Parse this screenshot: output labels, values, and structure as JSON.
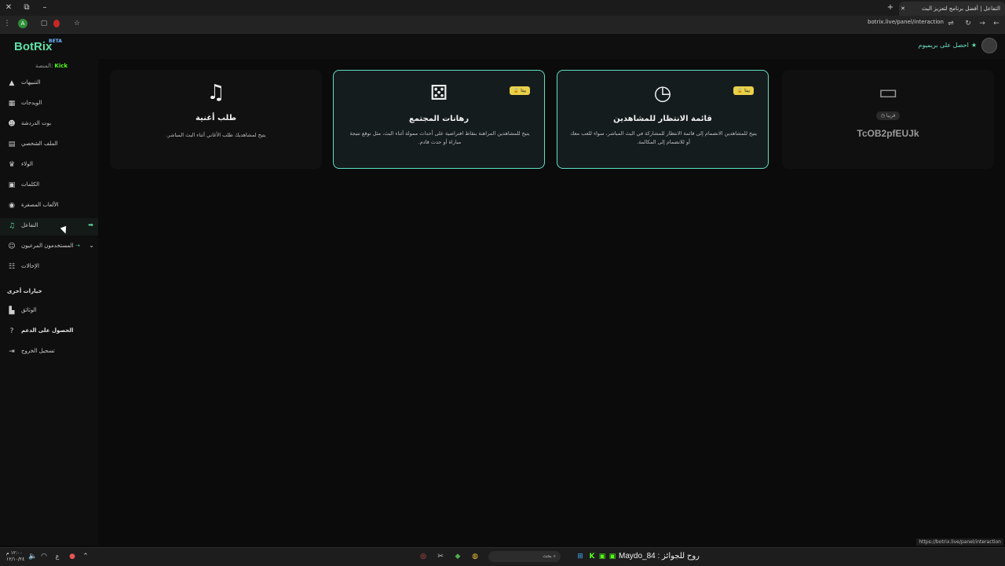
{
  "browser": {
    "tab_title": "التفاعل | أفضل برنامج لتعزيز البث",
    "url": "botrix.live/panel/interaction",
    "status_url": "https://botrix.live/panel/interaction"
  },
  "header": {
    "logo": "BotRix",
    "beta": "BETA",
    "premium_label": "احصل على بريميوم"
  },
  "sidebar": {
    "platform_label": "المنصة:",
    "platform_name": "Kick",
    "items": [
      {
        "label": "التنبيهات",
        "icon": "alert-icon"
      },
      {
        "label": "الويدجات",
        "icon": "grid-icon"
      },
      {
        "label": "بوت الدردشة",
        "icon": "robot-icon"
      },
      {
        "label": "الملف الشخصي",
        "icon": "id-card-icon"
      },
      {
        "label": "الولاء",
        "icon": "trophy-icon"
      },
      {
        "label": "الكلمات",
        "icon": "square-icon"
      },
      {
        "label": "الألعاب المصغرة",
        "icon": "gamepad-icon"
      },
      {
        "label": "التفاعل",
        "icon": "music-icon"
      },
      {
        "label": "المستخدمون المرعيون",
        "icon": "users-icon"
      },
      {
        "label": "الإحالات",
        "icon": "referral-icon"
      }
    ],
    "section_other": "خيارات أخرى",
    "other_items": [
      {
        "label": "الوثائق",
        "icon": "book-icon"
      },
      {
        "label": "الحصول على الدعم",
        "icon": "help-icon"
      },
      {
        "label": "تسجيل الخروج",
        "icon": "logout-icon"
      }
    ]
  },
  "cards": [
    {
      "title": "طلب أغنية",
      "desc": "يتيح لمشاهديك طلب الأغاني أثناء البث المباشر.",
      "icon": "music-icon",
      "badge": ""
    },
    {
      "title": "رهانات المجتمع",
      "desc": "يتيح للمشاهدين المراهنة بنقاط افتراضية على أحداث ممولة أثناء البث، مثل توقع نتيجة مباراة أو حدث قادم.",
      "icon": "dice-icon",
      "badge": "بيتا"
    },
    {
      "title": "قائمة الانتظار للمشاهدين",
      "desc": "يتيح للمشاهدين الانضمام إلى قائمة الانتظار للمشاركة في البث المباشر، سواء للعب معك أو للانضمام إلى المكالمة.",
      "icon": "clock-icon",
      "badge": "بيتا"
    },
    {
      "title": "",
      "desc": "",
      "icon": "ticket-icon",
      "badge": "",
      "chip": "قريبا",
      "code": "TcOB2pfEUJk"
    }
  ],
  "taskbar": {
    "time": "١٢:٠٠ م",
    "date": "١٢/١٠/٢٤",
    "lang": "ع",
    "search": "بحث",
    "window_title": "روح للجوائز : Maydo_84"
  }
}
